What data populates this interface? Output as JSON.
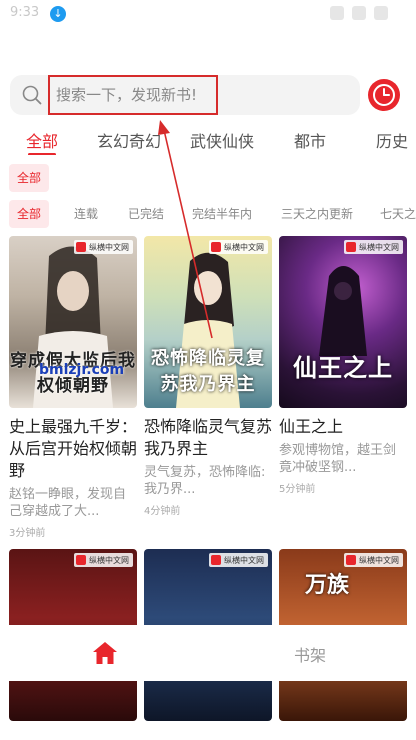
{
  "status_bar": {
    "time": "9:33"
  },
  "search": {
    "placeholder": "搜索一下，发现新书!"
  },
  "tabs": [
    {
      "label": "全部"
    },
    {
      "label": "玄幻奇幻"
    },
    {
      "label": "武侠仙侠"
    },
    {
      "label": "都市"
    },
    {
      "label": "历史"
    }
  ],
  "sub_filter": {
    "label": "全部"
  },
  "filters": [
    {
      "label": "全部"
    },
    {
      "label": "连载"
    },
    {
      "label": "已完结"
    },
    {
      "label": "完结半年内"
    },
    {
      "label": "三天之内更新"
    },
    {
      "label": "七天之"
    }
  ],
  "books": [
    {
      "cover_text": "穿成假太监后我权倾朝野",
      "title": "史上最强九千岁：从后宫开始权倾朝野",
      "desc": "赵铭一睁眼，发现自己穿越成了大...",
      "time": "3分钟前",
      "badge": "纵横中文网",
      "watermark": "bmlzjr.com"
    },
    {
      "cover_text": "恐怖降临灵复苏我乃界主",
      "title": "恐怖降临灵气复苏我乃界主",
      "desc": "灵气复苏，恐怖降临:我乃界...",
      "time": "4分钟前",
      "badge": "纵横中文网"
    },
    {
      "cover_text": "仙王之上",
      "title": "仙王之上",
      "desc": "参观博物馆，越王剑竟冲破坚钢...",
      "time": "5分钟前",
      "badge": "纵横中文网"
    },
    {
      "badge": "纵横中文网"
    },
    {
      "badge": "纵横中文网"
    },
    {
      "badge": "纵横中文网",
      "cover_text": "万族"
    }
  ],
  "bottom_nav": {
    "shelf_label": "书架"
  },
  "colors": {
    "accent": "#e8262c",
    "highlight_box": "#d62b2b"
  }
}
